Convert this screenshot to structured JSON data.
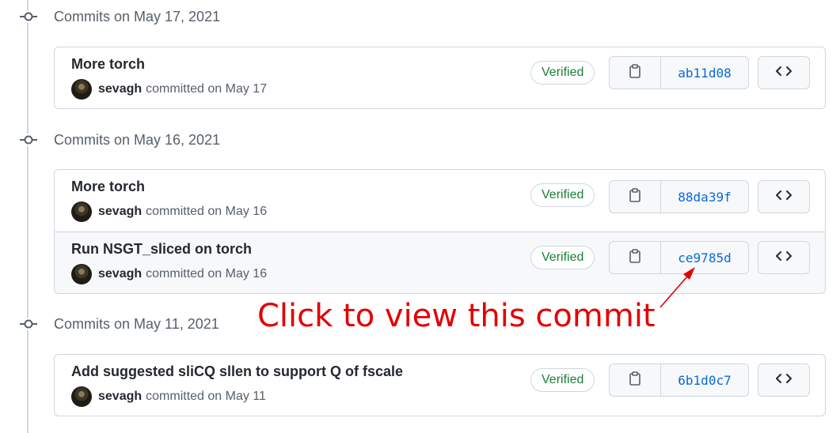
{
  "groups": [
    {
      "title": "Commits on May 17, 2021",
      "commits": [
        {
          "title": "More torch",
          "author": "sevagh",
          "committed": "committed on May 17",
          "verified": "Verified",
          "sha": "ab11d08"
        }
      ]
    },
    {
      "title": "Commits on May 16, 2021",
      "commits": [
        {
          "title": "More torch",
          "author": "sevagh",
          "committed": "committed on May 16",
          "verified": "Verified",
          "sha": "88da39f"
        },
        {
          "title": "Run NSGT_sliced on torch",
          "author": "sevagh",
          "committed": "committed on May 16",
          "verified": "Verified",
          "sha": "ce9785d"
        }
      ]
    },
    {
      "title": "Commits on May 11, 2021",
      "commits": [
        {
          "title": "Add suggested sliCQ sllen to support Q of fscale",
          "author": "sevagh",
          "committed": "committed on May 11",
          "verified": "Verified",
          "sha": "6b1d0c7"
        }
      ]
    }
  ],
  "annotation": {
    "text": "Click to view this commit",
    "color": "#e40000"
  },
  "icons": {
    "timeline": "git-commit-icon",
    "copy": "clipboard-icon",
    "browse": "code-icon"
  },
  "colors": {
    "verified": "#1a7f37",
    "sha_link": "#0969da",
    "border": "#d0d7de",
    "muted_text": "#57606a"
  }
}
